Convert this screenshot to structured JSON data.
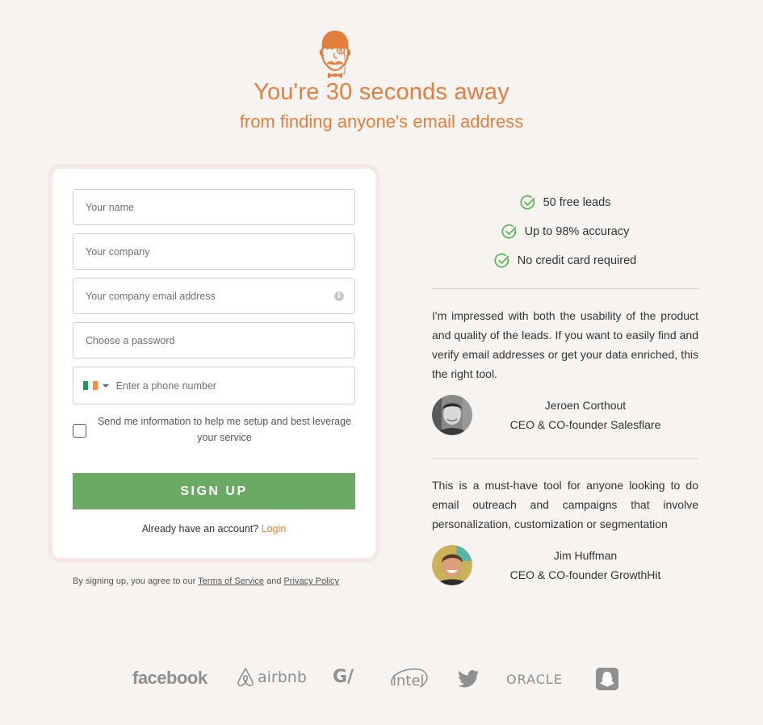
{
  "hero": {
    "headline": "You're 30 seconds away",
    "subheadline": "from finding anyone's email address",
    "mascot_icon": "monocle-gentleman-mascot-icon",
    "accent_color": "#e37f3d"
  },
  "form": {
    "fields": {
      "name": {
        "placeholder": "Your name",
        "value": ""
      },
      "company": {
        "placeholder": "Your company",
        "value": ""
      },
      "email": {
        "placeholder": "Your company email address",
        "value": "",
        "icon": "info-icon",
        "info_glyph": "i"
      },
      "password": {
        "placeholder": "Choose a password",
        "value": ""
      },
      "phone": {
        "placeholder": "Enter a phone number",
        "value": "",
        "country_flag": "Ireland",
        "flag_colors": [
          "#169b62",
          "#ffffff",
          "#ff883e"
        ]
      }
    },
    "consent_checkbox": {
      "label": "Send me information to help me setup and best leverage your service",
      "checked": false
    },
    "signup_label": "SIGN UP",
    "signup_color": "#6aaa64",
    "already_text": "Already have an account?",
    "login_label": "Login"
  },
  "terms": {
    "prefix": "By signing up, you agree to our",
    "terms_label": "Terms of Service",
    "conjunction": "and",
    "privacy_label": "Privacy Policy"
  },
  "perks": [
    {
      "icon": "check-circle-icon",
      "label": "50 free leads"
    },
    {
      "icon": "check-circle-icon",
      "label": "Up to 98% accuracy"
    },
    {
      "icon": "check-circle-icon",
      "label": "No credit card required"
    }
  ],
  "testimonials": [
    {
      "quote": "I'm impressed with both the usability of the product and quality of the leads. If you want to easily find and verify email addresses or get your data enriched, this the right tool.",
      "name": "Jeroen Corthout",
      "title": "CEO & CO-founder Salesflare"
    },
    {
      "quote": "This is a must-have tool for anyone looking to do email outreach and campaigns that involve personalization, customization or segmentation",
      "name": "Jim Huffman",
      "title": "CEO & CO-founder GrowthHit"
    }
  ],
  "customer_logos": [
    {
      "name": "facebook",
      "text": "facebook"
    },
    {
      "name": "airbnb",
      "text": "airbnb"
    },
    {
      "name": "g2",
      "text": "G/"
    },
    {
      "name": "intel",
      "text": "intel"
    },
    {
      "name": "twitter",
      "text": ""
    },
    {
      "name": "oracle",
      "text": "ORACLE"
    },
    {
      "name": "snapchat",
      "text": ""
    }
  ]
}
